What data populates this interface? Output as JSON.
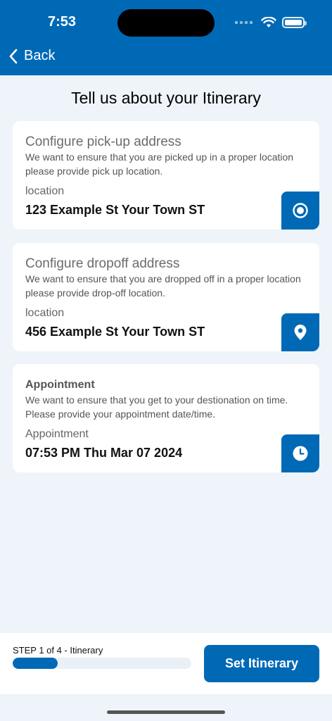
{
  "status_bar": {
    "time": "7:53"
  },
  "nav": {
    "back_label": "Back"
  },
  "page": {
    "title": "Tell us about your Itinerary"
  },
  "pickup": {
    "title": "Configure pick-up address",
    "description": "We want to ensure that you are picked up in a proper location please provide pick up location.",
    "field_label": "location",
    "value": "123 Example St Your Town ST",
    "icon": "radio-target-icon"
  },
  "dropoff": {
    "title": "Configure dropoff address",
    "description": "We want to ensure that you are dropped off in a proper location please provide drop-off location.",
    "field_label": "location",
    "value": "456 Example St Your Town ST",
    "icon": "map-pin-icon"
  },
  "appointment": {
    "title": "Appointment",
    "description": "We want to ensure that you get to your destionation on time. Please provide your appointment date/time.",
    "field_label": "Appointment",
    "value": "07:53 PM Thu Mar 07 2024",
    "icon": "clock-icon"
  },
  "footer": {
    "step_label": "STEP 1 of 4 - Itinerary",
    "progress_fraction": 0.25,
    "button_label": "Set Itinerary"
  },
  "colors": {
    "brand": "#0069b6",
    "background": "#eef4f9"
  }
}
